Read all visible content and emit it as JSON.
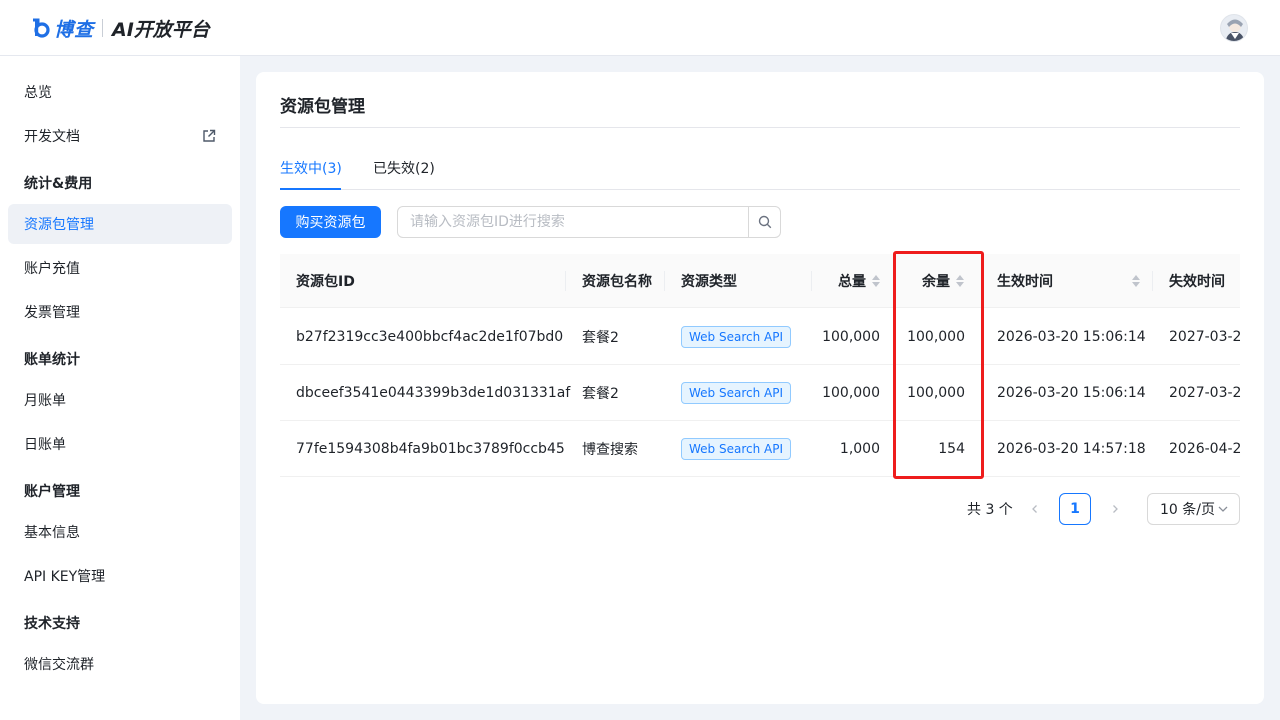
{
  "header": {
    "brand": "博查",
    "platform_title": "AI开放平台",
    "brand_color": "#1f6fe5"
  },
  "sidebar": {
    "items": [
      {
        "label": "总览"
      },
      {
        "label": "开发文档",
        "icon": "external-link-icon"
      },
      {
        "group": "统计&费用"
      },
      {
        "label": "资源包管理",
        "active": true
      },
      {
        "label": "账户充值"
      },
      {
        "label": "发票管理"
      },
      {
        "group": "账单统计"
      },
      {
        "label": "月账单"
      },
      {
        "label": "日账单"
      },
      {
        "group": "账户管理"
      },
      {
        "label": "基本信息"
      },
      {
        "label": "API KEY管理"
      },
      {
        "group": "技术支持"
      },
      {
        "label": "微信交流群"
      }
    ]
  },
  "main": {
    "title": "资源包管理",
    "tabs": [
      {
        "label": "生效中(3)",
        "active": true
      },
      {
        "label": "已失效(2)",
        "active": false
      }
    ],
    "buy_button": "购买资源包",
    "search": {
      "placeholder": "请输入资源包ID进行搜索",
      "value": "",
      "icon": "search-icon"
    },
    "table": {
      "columns": [
        "资源包ID",
        "资源包名称",
        "资源类型",
        "总量",
        "余量",
        "生效时间",
        "失效时间"
      ],
      "rows": [
        {
          "id": "b27f2319cc3e400bbcf4ac2de1f07bd0",
          "name": "套餐2",
          "type": "Web Search API",
          "total": "100,000",
          "remaining": "100,000",
          "start": "2026-03-20 15:06:14",
          "end": "2027-03-2"
        },
        {
          "id": "dbceef3541e0443399b3de1d031331af",
          "name": "套餐2",
          "type": "Web Search API",
          "total": "100,000",
          "remaining": "100,000",
          "start": "2026-03-20 15:06:14",
          "end": "2027-03-2"
        },
        {
          "id": "77fe1594308b4fa9b01bc3789f0ccb45",
          "name": "博查搜索",
          "type": "Web Search API",
          "total": "1,000",
          "remaining": "154",
          "start": "2026-03-20 14:57:18",
          "end": "2026-04-2"
        }
      ],
      "highlight_color": "#ee1c1c"
    },
    "pagination": {
      "total_label": "共 3 个",
      "current_page": "1",
      "page_size": "10 条/页"
    }
  },
  "colors": {
    "accent": "#1677ff",
    "background": "#f0f3f8"
  }
}
